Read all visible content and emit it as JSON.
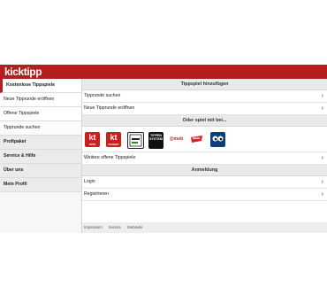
{
  "brand": {
    "logo_text": "kicktipp",
    "accent": "#b41e1e"
  },
  "sidebar": {
    "items": [
      {
        "label": "Kostenlose Tippspiele",
        "kind": "section-active"
      },
      {
        "label": "Neue Tipprunde eröffnen",
        "kind": "sub"
      },
      {
        "label": "Offene Tippspiele",
        "kind": "sub"
      },
      {
        "label": "Tipprunde suchen",
        "kind": "sub"
      },
      {
        "label": "Profipaket",
        "kind": "section"
      },
      {
        "label": "Service & Hilfe",
        "kind": "section"
      },
      {
        "label": "Über uns",
        "kind": "section"
      },
      {
        "label": "Mein Profil",
        "kind": "section"
      }
    ]
  },
  "main": {
    "add_section_title": "Tippspiel hinzufügen",
    "add_rows": [
      "Tipprunde suchen",
      "Neue Tipprunde eröffnen"
    ],
    "other_section_title": "Oder spiel mit bei...",
    "game_icons": [
      {
        "name": "kt-app-icon",
        "text": "kt",
        "sub": "TIPPS"
      },
      {
        "name": "kt-app-icon-2",
        "text": "kt",
        "sub": "ZOCKERY"
      },
      {
        "name": "tipp-icon"
      },
      {
        "name": "tippen-icon",
        "text": "TIPPEN\nSYSTEM"
      },
      {
        "name": "mob-icon",
        "text": "@mob"
      },
      {
        "name": "red-badge-icon"
      },
      {
        "name": "eyes-icon"
      }
    ],
    "more_games_label": "Weitere offene Tippspiele",
    "login_section_title": "Anmeldung",
    "login_rows": [
      "Login",
      "Registrieren"
    ],
    "footer_links": [
      "Impressum",
      "Service",
      "Webseite"
    ]
  }
}
